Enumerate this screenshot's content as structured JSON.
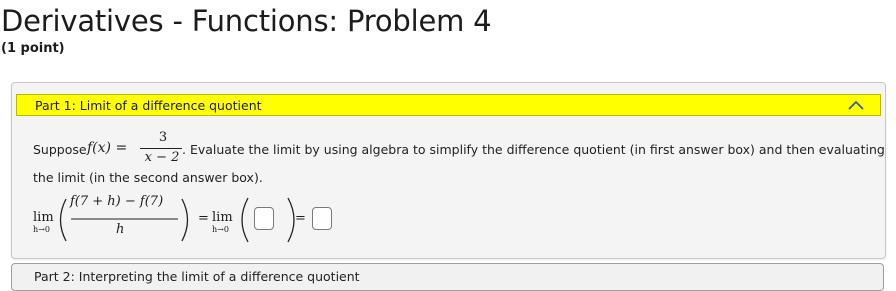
{
  "problem": {
    "title": "Derivatives - Functions: Problem 4",
    "points": "(1 point)"
  },
  "part1": {
    "header": "Part 1: Limit of a difference quotient",
    "text_suppose": "Suppose",
    "func_lhs": "f(x) =",
    "func_num": "3",
    "func_den": "x − 2",
    "text_rest": ". Evaluate the limit by using algebra to simplify the difference quotient (in first answer box) and then evaluating",
    "text_line2": "the limit (in the second answer box).",
    "lim_word": "lim",
    "lim_sub": "h→0",
    "dq_num": "f(7 + h) − f(7)",
    "dq_den": "h",
    "equals": "=",
    "answer1_value": "",
    "answer2_value": ""
  },
  "part2": {
    "header": "Part 2: Interpreting the limit of a difference quotient"
  },
  "icons": {
    "collapse": "chevron-up-icon"
  }
}
